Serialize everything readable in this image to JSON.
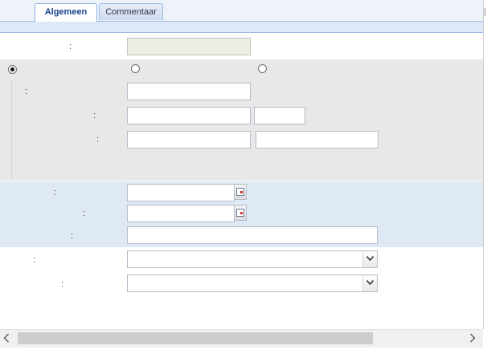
{
  "tabs": [
    {
      "label": "Algemeen",
      "active": true
    },
    {
      "label": "Commentaar",
      "active": false
    }
  ],
  "form": {
    "colon": ":",
    "radio_group": {
      "selected_index": 0,
      "options": [
        "",
        "",
        ""
      ]
    },
    "fields": {
      "field_1": {
        "value": "",
        "disabled": true
      },
      "field_2": {
        "value": ""
      },
      "field_3a": {
        "value": ""
      },
      "field_3b": {
        "value": ""
      },
      "field_4a": {
        "value": ""
      },
      "field_4b": {
        "value": ""
      },
      "date_1": {
        "value": ""
      },
      "date_2": {
        "value": ""
      },
      "field_wide": {
        "value": ""
      },
      "combo_1": {
        "value": ""
      },
      "combo_2": {
        "value": ""
      }
    }
  },
  "icons": {
    "date_picker": "calendar-icon",
    "combo_trigger": "chevron-down-icon",
    "scroll_left": "chevron-left-icon",
    "scroll_right": "chevron-right-icon"
  },
  "colors": {
    "tab_text_active": "#15428b",
    "tab_border": "#99bbe8",
    "section_gray": "#e8e8e8",
    "section_blue": "#dfe9f5"
  }
}
